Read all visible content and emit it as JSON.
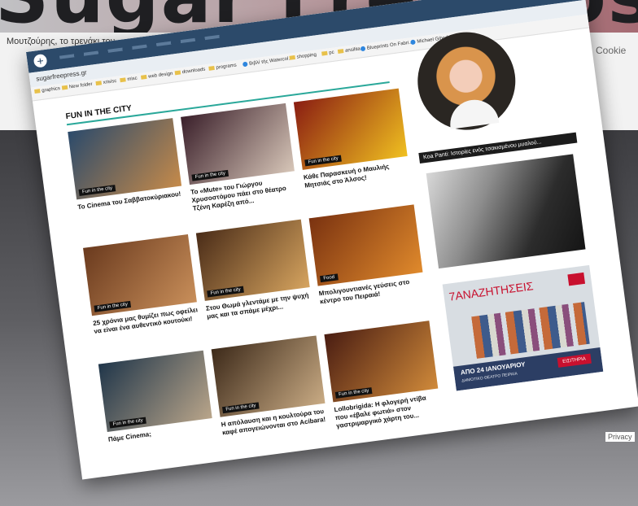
{
  "background": {
    "headline": "Sugar Free Post",
    "article_title": "Μουτζούρης, το τρενάκι του",
    "article_sub": "",
    "cookie": "Cookie",
    "privacy": "Privacy"
  },
  "browser": {
    "url": "sugarfreepress.gr",
    "bookmarks": [
      {
        "label": "graphics",
        "icon": "folder-icon"
      },
      {
        "label": "New folder",
        "icon": "folder-icon"
      },
      {
        "label": "xrisisc",
        "icon": "folder-icon"
      },
      {
        "label": "misc",
        "icon": "folder-icon"
      },
      {
        "label": "web design",
        "icon": "folder-icon"
      },
      {
        "label": "downloads",
        "icon": "folder-icon"
      },
      {
        "label": "programs",
        "icon": "folder-icon"
      },
      {
        "label": "Βιβλί τής Watercol...",
        "icon": "google-icon"
      },
      {
        "label": "shopping",
        "icon": "folder-icon"
      },
      {
        "label": "pc",
        "icon": "folder-icon"
      },
      {
        "label": "ansilita",
        "icon": "folder-icon"
      },
      {
        "label": "Blueprints On Fabri...",
        "icon": "google-icon"
      },
      {
        "label": "Michael Gibnd Artif...",
        "icon": "github-icon"
      }
    ]
  },
  "section": {
    "title": "FUN IN THE CITY"
  },
  "cards": [
    {
      "tag": "Fun in the city",
      "caption": "Το Cinema του Σαββατοκύριακου!",
      "colors": [
        "#2b4a6b",
        "#c58a4a"
      ]
    },
    {
      "tag": "Fun in the city",
      "caption": "Το «Mute» του Γιώργου Χρυσοστόμου πάει στο θέατρο Τζένη Καρέζη από...",
      "colors": [
        "#3a1f2a",
        "#d7c6b8"
      ]
    },
    {
      "tag": "Fun in the city",
      "caption": "Κάθε Παρασκευή ο Μαυλιής Μητσιάς στο Άλσος!",
      "colors": [
        "#8a1d12",
        "#f0c020"
      ]
    },
    {
      "tag": "Fun in the city",
      "caption": "25 χρόνια μας θυμίζει πως οφείλει να είναι ένα αυθεντικό κουτούκι!",
      "colors": [
        "#6a3a1e",
        "#c98f5a"
      ]
    },
    {
      "tag": "Fun in the city",
      "caption": "Στου Θωμά γλεντάμε με την ψυχή μας και τα σπάμε μέχρι...",
      "colors": [
        "#4a2c18",
        "#d6a45f"
      ]
    },
    {
      "tag": "Food",
      "caption": "Μπολιγουντιανές γεύσεις στο κέντρο του Πειραιά!",
      "colors": [
        "#7a3210",
        "#e08a2c"
      ]
    },
    {
      "tag": "Fun in the city",
      "caption": "Πάμε Cinema;",
      "colors": [
        "#20364a",
        "#b9a58a"
      ]
    },
    {
      "tag": "Fun in the city",
      "caption": "Η απόλαυση και η κουλτούρα του καφέ απογειώνονται στο Acibara!",
      "colors": [
        "#3d2a1a",
        "#c9ab84"
      ]
    },
    {
      "tag": "Fun in the city",
      "caption": "Lollobrigida: Η φλογερή ντίβα που «έβαλε φωτιά» στον γαστριμαργικό χάρτη του...",
      "colors": [
        "#4a1d12",
        "#d08a3a"
      ]
    }
  ],
  "sidebar": {
    "title": "Koa Panti: Ιστορίες ενός τσακισμένου μυαλού...",
    "ad": {
      "title": "7ΑΝΑΖΗΤΗΣΕΙΣ",
      "date": "ΑΠΟ 24 ΙΑΝΟΥΑΡΙΟΥ",
      "venue": "ΔΗΜΟΤΙΚΟ ΘΕΑΤΡΟ ΠΕΙΡΑΙΑ",
      "button": "ΕΙΣΙΤΗΡΙΑ"
    }
  }
}
